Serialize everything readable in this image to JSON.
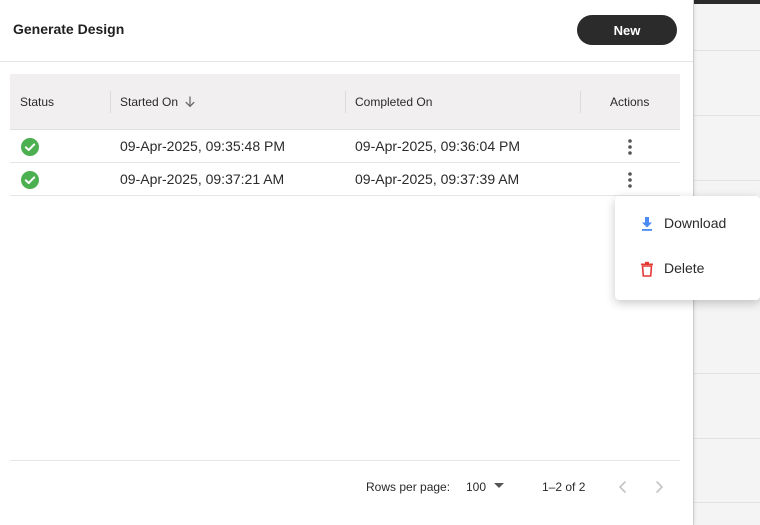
{
  "panel": {
    "title": "Generate Design",
    "new_button_label": "New"
  },
  "table": {
    "columns": [
      "Status",
      "Started On",
      "Completed On",
      "Actions"
    ],
    "sorted_column": "Started On",
    "sort_direction": "descending",
    "rows": [
      {
        "status": "completed",
        "started_on": "09-Apr-2025, 09:35:48 PM",
        "completed_on": "09-Apr-2025, 09:36:04 PM"
      },
      {
        "status": "completed",
        "started_on": "09-Apr-2025, 09:37:21 AM",
        "completed_on": "09-Apr-2025, 09:37:39 AM"
      }
    ]
  },
  "pagination": {
    "rows_per_page_label": "Rows per page:",
    "rows_per_page_value": "100",
    "range_text": "1–2 of 2"
  },
  "context_menu": {
    "items": [
      {
        "label": "Download",
        "icon": "download-icon"
      },
      {
        "label": "Delete",
        "icon": "trash-icon"
      }
    ]
  },
  "colors": {
    "accent_dark": "#2b2b2b",
    "success": "#4caf50",
    "download_blue": "#4a8af4",
    "delete_red": "#e53935"
  }
}
